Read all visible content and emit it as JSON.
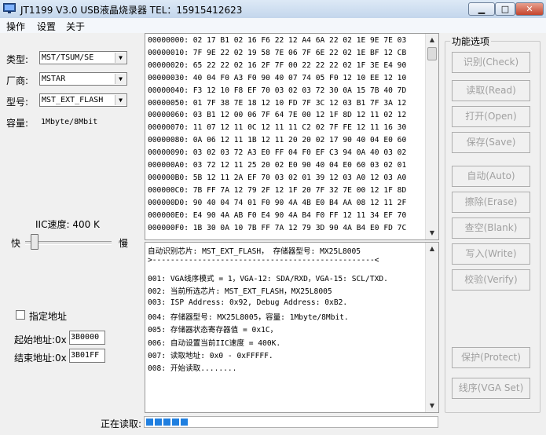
{
  "window": {
    "title": "JT1199 V3.0 USB液晶烧录器   TEL：15915412623",
    "minimize_icon": "minimize-icon",
    "maximize_icon": "maximize-icon",
    "close_icon": "close-icon"
  },
  "menu": {
    "items": [
      "操作",
      "设置",
      "关于"
    ]
  },
  "left": {
    "type_label": "类型:",
    "type_value": "MST/TSUM/SE",
    "maker_label": "厂商:",
    "maker_value": "MSTAR",
    "model_label": "型号:",
    "model_value": "MST_EXT_FLASH",
    "capacity_label": "容量:",
    "capacity_value": "1Mbyte/8Mbit",
    "iic_label": "IIC速度: 400 K",
    "fast_label": "快",
    "slow_label": "慢",
    "specify_addr_label": "指定地址",
    "start_label": "起始地址:0x",
    "start_value": "3B0000",
    "end_label": "结束地址:0x",
    "end_value": "3B01FF",
    "status_label": "正在读取:"
  },
  "hex": {
    "lines": [
      "00000000: 02 17 B1 02 16 F6 22 12 A4 6A 22 02 1E 9E 7E 03",
      "00000010: 7F 9E 22 02 19 58 7E 06 7F 6E 22 02 1E BF 12 CB",
      "00000020: 65 22 22 02 16 2F 7F 00 22 22 22 02 1F 3E E4 90",
      "00000030: 40 04 F0 A3 F0 90 40 07 74 05 F0 12 10 EE 12 10",
      "00000040: F3 12 10 F8 EF 70 03 02 03 72 30 0A 15 7B 40 7D",
      "00000050: 01 7F 38 7E 18 12 10 FD 7F 3C 12 03 B1 7F 3A 12",
      "00000060: 03 B1 12 00 06 7F 64 7E 00 12 1F 8D 12 11 02 12",
      "00000070: 11 07 12 11 0C 12 11 11 C2 02 7F FE 12 11 16 30",
      "00000080: 0A 06 12 11 1B 12 11 20 20 02 17 90 40 04 E0 60",
      "00000090: 03 02 03 72 A3 E0 FF 04 F0 EF C3 94 0A 40 03 02",
      "000000A0: 03 72 12 11 25 20 02 E0 90 40 04 E0 60 03 02 01",
      "000000B0: 5B 12 11 2A EF 70 03 02 01 39 12 03 A0 12 03 A0",
      "000000C0: 7B FF 7A 12 79 2F 12 1F 20 7F 32 7E 00 12 1F 8D",
      "000000D0: 90 40 04 74 01 F0 90 4A 4B E0 B4 AA 08 12 11 2F",
      "000000E0: E4 90 4A AB F0 E4 90 4A B4 F0 FF 12 11 34 EF 70",
      "000000F0: 1B 30 0A 10 7B FF 7A 12 79 3D 90 4A B4 E0 FD 7C"
    ]
  },
  "log": {
    "lines": [
      "自动识别芯片: MST_EXT_FLASH， 存储器型号: MX25L8005",
      ">-------------------------------------------------<",
      "",
      "001: VGA线序模式 = 1，VGA-12: SDA/RXD，VGA-15: SCL/TXD.",
      "002: 当前所选芯片: MST_EXT_FLASH，MX25L8005",
      "003: ISP Address: 0x92, Debug Address: 0xB2.",
      "004: 存储器型号: MX25L8005，容量: 1Mbyte/8Mbit.",
      "005: 存储器状态寄存器值 = 0x1C，",
      "006: 自动设置当前IIC速度 = 400K.",
      "007: 读取地址: 0x0 - 0xFFFFF.",
      "008: 开始读取........"
    ]
  },
  "functions": {
    "group_title": "功能选项",
    "buttons": [
      "识别(Check)",
      "读取(Read)",
      "打开(Open)",
      "保存(Save)",
      "自动(Auto)",
      "擦除(Erase)",
      "查空(Blank)",
      "写入(Write)",
      "校验(Verify)",
      "保护(Protect)",
      "线序(VGA Set)"
    ]
  },
  "progress": {
    "value": 0.145,
    "blocks": 5
  },
  "colors": {
    "titlebar": "#c9dcef",
    "progress": "#1f7fe0",
    "disabled_text": "#a0a0a0"
  }
}
